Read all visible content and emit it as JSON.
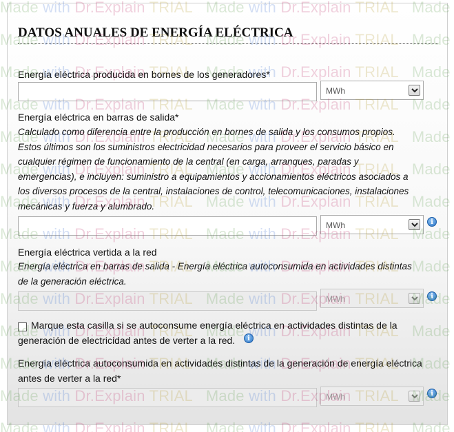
{
  "form": {
    "title": "DATOS ANUALES DE ENERGÍA ELÉCTRICA",
    "fields": [
      {
        "label": "Energía eléctrica producida en bornes de los generadores*",
        "value": "",
        "unit": "MWh",
        "disabled": false,
        "info": false
      },
      {
        "label": "Energía eléctrica en barras de salida*",
        "description": [
          "Calculado como diferencia entre la producción en bornes de salida y los consumos propios.",
          "Estos últimos son los suministros electricidad necesarios para proveer el servicio básico en",
          "cualquier régimen de funcionamiento de la central (en carga, arranques, paradas y",
          "emergencias), e incluyen: suministro a equipamientos y accionamientos eléctricos asociados a",
          "los diversos procesos de la central, instalaciones de control, telecomunicaciones, instalaciones",
          "mecánicas y fuerza y alumbrado."
        ],
        "value": "",
        "unit": "MWh",
        "disabled": false,
        "info": true
      },
      {
        "label": "Energía eléctrica vertida a la red",
        "description": [
          "Energía eléctrica en barras de salida - Energía eléctrica autoconsumida en actividades distintas",
          "de la generación eléctrica."
        ],
        "value": "",
        "unit": "MWh",
        "disabled": true,
        "info": true
      },
      {
        "label": "Energía eléctrica autoconsumida en actividades distintas de la generación de energía eléctrica",
        "label_line2": "antes de verter a la red*",
        "value": "",
        "unit": "MWh",
        "disabled": true,
        "info": true
      }
    ],
    "checkbox": {
      "checked": false,
      "label_line1": "Marque esta casilla si se autoconsume energía eléctrica en actividades distintas de la",
      "label_line2": "generación de electricidad antes de verter a la red."
    }
  },
  "info_icon_glyph": "i",
  "watermark": {
    "made": "Made",
    "with": "with",
    "drexplain": "Dr.Explain",
    "trial": "TRIAL"
  }
}
